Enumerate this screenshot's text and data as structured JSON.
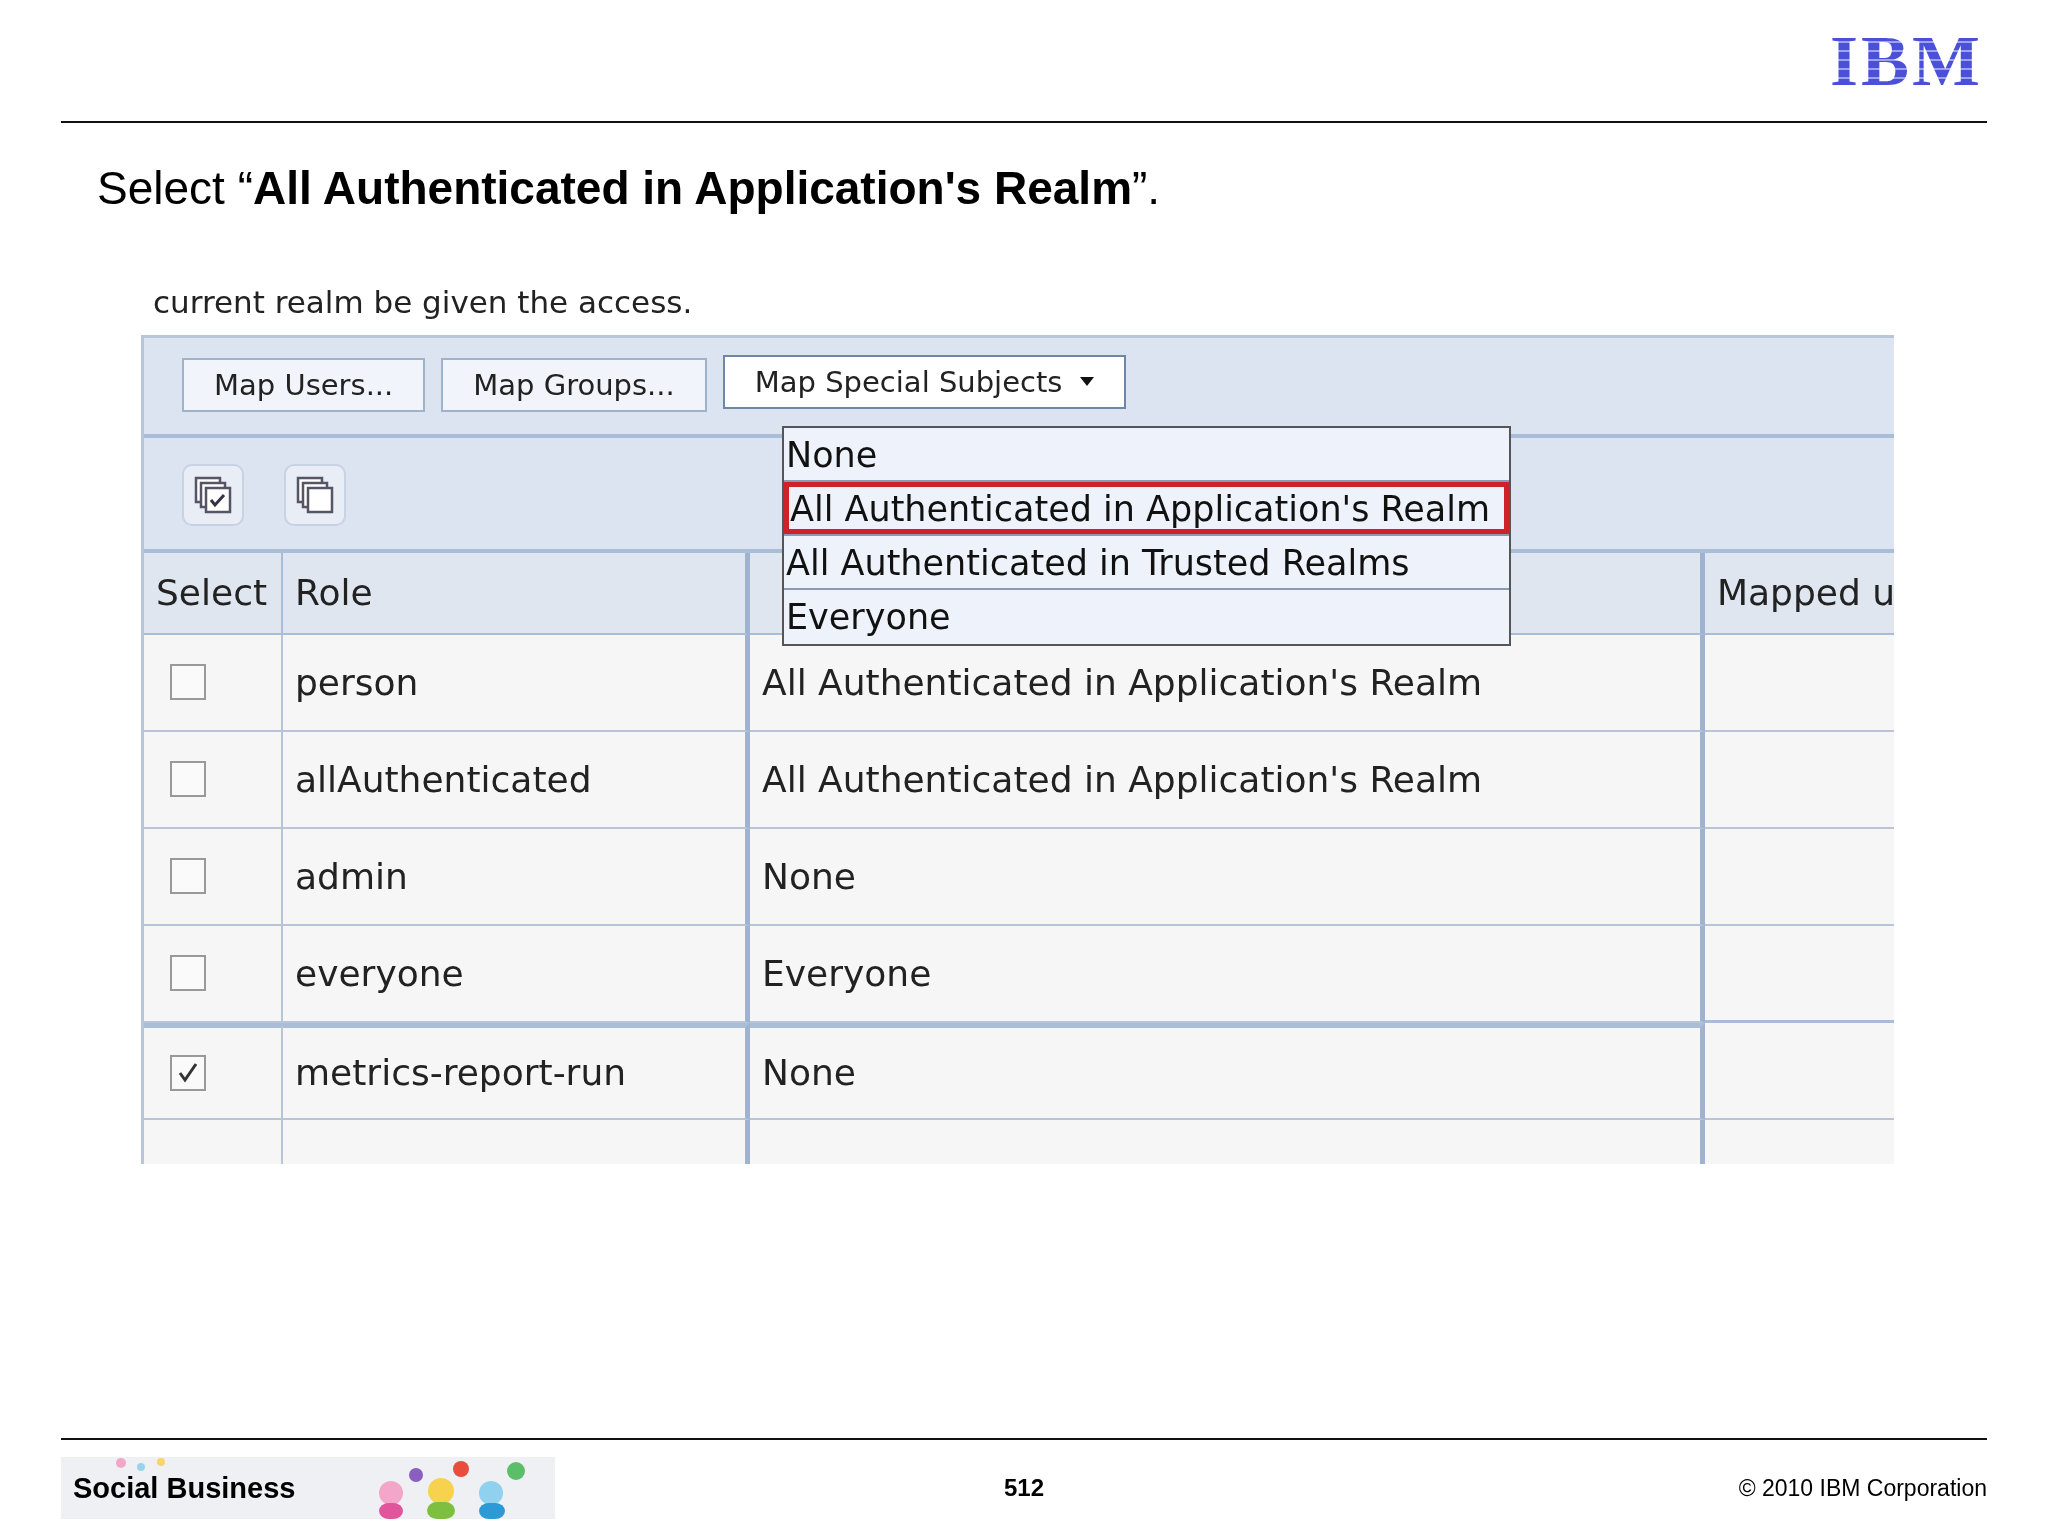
{
  "logo": "IBM",
  "title": "Select “**All Authenticated in Application's Realm**”.",
  "screenshot": {
    "intro": "current realm be given the access.",
    "buttons": [
      {
        "label": "Map Users...",
        "kind": "button"
      },
      {
        "label": "Map Groups...",
        "kind": "button"
      },
      {
        "label": "Map Special Subjects",
        "kind": "menu",
        "expanded": true
      }
    ],
    "dropdown": [
      {
        "label": "None",
        "selected": false
      },
      {
        "label": "All Authenticated in Application's Realm",
        "selected": true
      },
      {
        "label": "All Authenticated in Trusted Realms",
        "selected": false
      },
      {
        "label": "Everyone",
        "selected": false
      }
    ],
    "table": {
      "columns": {
        "select": "Select",
        "role": "Role",
        "column_4": "Mapped u"
      },
      "rows": [
        {
          "checked": false,
          "role": "person",
          "special_subject": "All Authenticated in Application's Realm"
        },
        {
          "checked": false,
          "role": "allAuthenticated",
          "special_subject": "All Authenticated in Application's Realm"
        },
        {
          "checked": false,
          "role": "admin",
          "special_subject": "None"
        },
        {
          "checked": false,
          "role": "everyone",
          "special_subject": "Everyone"
        },
        {
          "checked": true,
          "role": "metrics-report-run",
          "special_subject": "None"
        }
      ]
    }
  },
  "footer": {
    "brand": "Social Business",
    "page": "512",
    "copyright": "© 2010 IBM Corporation"
  }
}
